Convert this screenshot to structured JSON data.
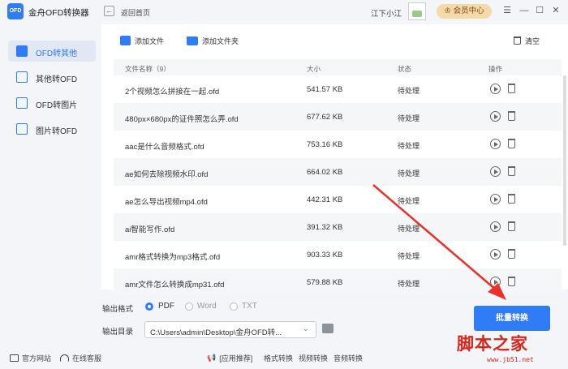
{
  "app": {
    "logo_text": "OFD",
    "title": "金舟OFD转换器"
  },
  "header": {
    "back_label": "返回首页",
    "user_name": "江下小江",
    "vip_label": "会员中心",
    "controls": [
      "☰",
      "—",
      "☐",
      "✕"
    ]
  },
  "sidebar": {
    "items": [
      {
        "label": "OFD转其他",
        "active": true
      },
      {
        "label": "其他转OFD",
        "active": false
      },
      {
        "label": "OFD转图片",
        "active": false
      },
      {
        "label": "图片转OFD",
        "active": false
      }
    ]
  },
  "toolbar": {
    "add_file": "添加文件",
    "add_folder": "添加文件夹",
    "clear": "清空"
  },
  "table": {
    "columns": {
      "name": "文件名称（9）",
      "size": "大小",
      "status": "状态",
      "action": "操作"
    },
    "rows": [
      {
        "name": "2个视频怎么拼接在一起.ofd",
        "size": "541.57 KB",
        "status": "待处理"
      },
      {
        "name": "480px×680px的证件照怎么弄.ofd",
        "size": "677.62 KB",
        "status": "待处理"
      },
      {
        "name": "aac是什么音频格式.ofd",
        "size": "753.16 KB",
        "status": "待处理"
      },
      {
        "name": "ae如何去除视频水印.ofd",
        "size": "664.02 KB",
        "status": "待处理"
      },
      {
        "name": "ae怎么导出视频mp4.ofd",
        "size": "442.31 KB",
        "status": "待处理"
      },
      {
        "name": "ai智能写作.ofd",
        "size": "391.32 KB",
        "status": "待处理"
      },
      {
        "name": "amr格式转换为mp3格式.ofd",
        "size": "903.33 KB",
        "status": "待处理"
      },
      {
        "name": "amr文件怎么转换成mp31.ofd",
        "size": "579.88 KB",
        "status": "待处理"
      }
    ]
  },
  "output": {
    "format_label": "输出格式",
    "formats": [
      {
        "label": "PDF",
        "selected": true
      },
      {
        "label": "Word",
        "selected": false
      },
      {
        "label": "TXT",
        "selected": false
      }
    ],
    "dir_label": "输出目录",
    "dir_value": "C:\\Users\\admin\\Desktop\\金舟OFD转...",
    "convert_label": "批量转换"
  },
  "footer": {
    "website": "官方网站",
    "service": "在线客服",
    "recommend": "[应用推荐]",
    "links": [
      "格式转换",
      "视频转换",
      "音频转换"
    ]
  },
  "watermark": {
    "big": "脚本之家",
    "small": "www.jb51.net"
  },
  "colors": {
    "accent": "#2f7cf6",
    "vip_bg": "#f5d9a8",
    "arrow": "#e8322b"
  }
}
